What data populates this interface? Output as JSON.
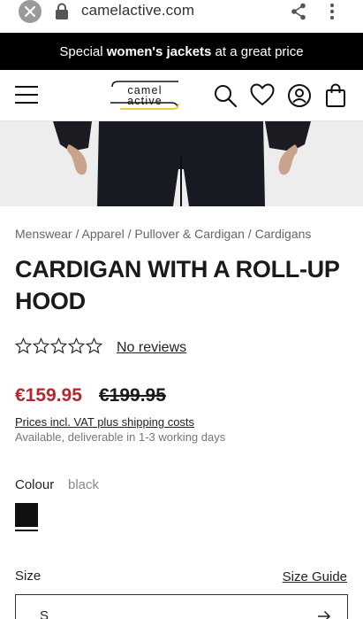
{
  "browser": {
    "url": "camelactive.com"
  },
  "promo": {
    "prefix": "Special ",
    "bold": "women's jackets",
    "suffix": " at a great price"
  },
  "header": {
    "logo_line1": "camel",
    "logo_line2": "active"
  },
  "breadcrumb": "Menswear / Apparel / Pullover & Cardigan / Cardigans",
  "product": {
    "title": "CARDIGAN WITH A ROLL-UP HOOD",
    "rating_stars": 0,
    "rating_max": 5,
    "reviews_link": "No reviews",
    "price": "€159.95",
    "old_price": "€199.95",
    "vat_link": "Prices incl. VAT plus shipping costs",
    "availability": "Available, deliverable in 1-3 working days"
  },
  "colour": {
    "label": "Colour",
    "value": "black",
    "swatch_color": "#0f1012"
  },
  "size": {
    "label": "Size",
    "guide_link": "Size Guide",
    "selected": "S"
  },
  "colors": {
    "price_red": "#b3282d",
    "logo_accent": "#e8d238"
  }
}
